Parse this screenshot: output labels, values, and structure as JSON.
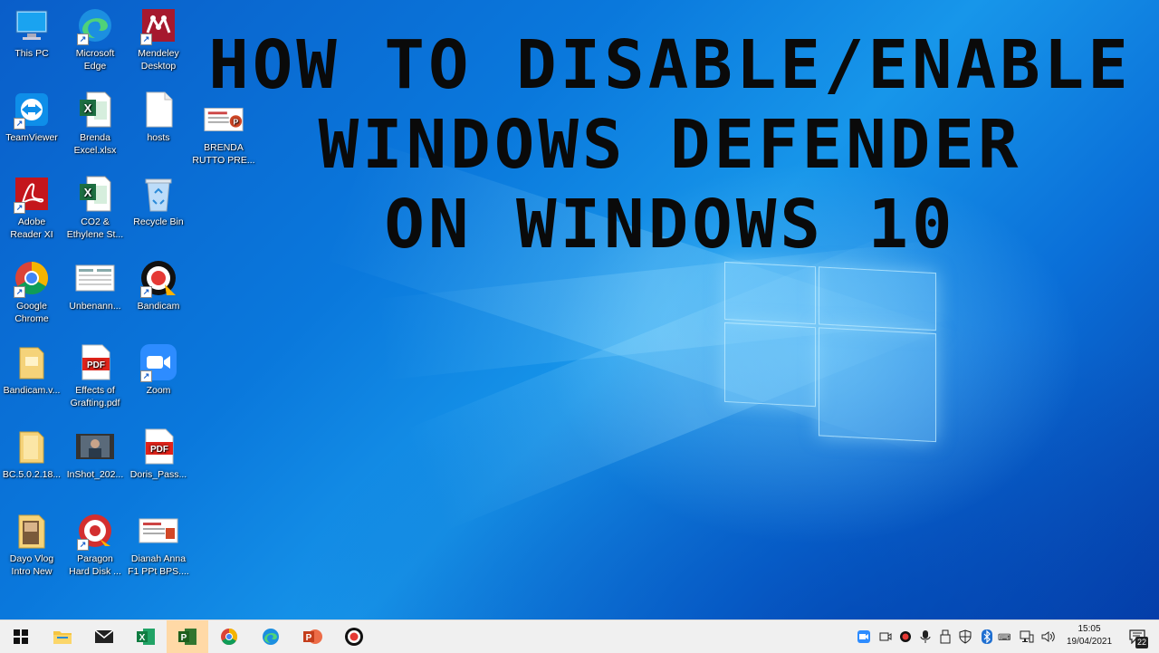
{
  "headline": {
    "line1": "How to Disable/Enable",
    "line2": "Windows Defender",
    "line3": "on Windows 10"
  },
  "desktop_icons": [
    {
      "label": "This PC",
      "icon": "this-pc-icon"
    },
    {
      "label": "Microsoft\nEdge",
      "icon": "edge-icon"
    },
    {
      "label": "Mendeley\nDesktop",
      "icon": "mendeley-icon"
    },
    {
      "label": "TeamViewer",
      "icon": "teamviewer-icon"
    },
    {
      "label": "Brenda\nExcel.xlsx",
      "icon": "excel-file-icon"
    },
    {
      "label": "hosts",
      "icon": "blank-file-icon"
    },
    {
      "label": "BRENDA\nRUTTO PRE...",
      "icon": "powerpoint-file-icon"
    },
    {
      "label": "Adobe\nReader XI",
      "icon": "adobe-reader-icon"
    },
    {
      "label": "CO2 &\nEthylene St...",
      "icon": "excel-file-icon"
    },
    {
      "label": "Recycle Bin",
      "icon": "recycle-bin-icon"
    },
    {
      "label": "Google\nChrome",
      "icon": "chrome-icon"
    },
    {
      "label": "Unbenann...",
      "icon": "document-thumbnail-icon"
    },
    {
      "label": "Bandicam",
      "icon": "bandicam-icon"
    },
    {
      "label": "Bandicam.v...",
      "icon": "folder-icon"
    },
    {
      "label": "Effects of\nGrafting.pdf",
      "icon": "pdf-icon"
    },
    {
      "label": "Zoom",
      "icon": "zoom-icon"
    },
    {
      "label": "BC.5.0.2.18...",
      "icon": "folder-icon"
    },
    {
      "label": "InShot_202...",
      "icon": "video-thumbnail-icon"
    },
    {
      "label": "Doris_Pass...",
      "icon": "pdf-icon"
    },
    {
      "label": "Dayo Vlog\nIntro New",
      "icon": "photo-folder-icon"
    },
    {
      "label": "Paragon\nHard Disk ...",
      "icon": "paragon-icon"
    },
    {
      "label": "Dianah Anna\nF1 PPt BPS....",
      "icon": "powerpoint-file-icon"
    }
  ],
  "taskbar": {
    "apps": [
      {
        "name": "start-button",
        "icon": "windows-icon"
      },
      {
        "name": "file-explorer",
        "icon": "folder-icon"
      },
      {
        "name": "mail",
        "icon": "mail-icon"
      },
      {
        "name": "excel",
        "icon": "excel-icon"
      },
      {
        "name": "project",
        "icon": "project-icon"
      },
      {
        "name": "chrome",
        "icon": "chrome-icon"
      },
      {
        "name": "edge",
        "icon": "edge-icon"
      },
      {
        "name": "powerpoint",
        "icon": "powerpoint-icon"
      },
      {
        "name": "bandicam",
        "icon": "bandicam-icon"
      }
    ],
    "tray_icons": [
      "zoom-icon",
      "meet-now-icon",
      "record-icon",
      "microphone-icon",
      "usb-icon",
      "defender-icon",
      "bluetooth-icon",
      "input-icon",
      "network-icon",
      "volume-icon"
    ],
    "time": "15:05",
    "date": "19/04/2021",
    "notification_count": "22"
  },
  "colors": {
    "desktop_blue": "#0a78dc",
    "taskbar_bg": "#f0f0f0",
    "active_task": "#ffd9a6",
    "headline_text": "#0a0a0a"
  }
}
